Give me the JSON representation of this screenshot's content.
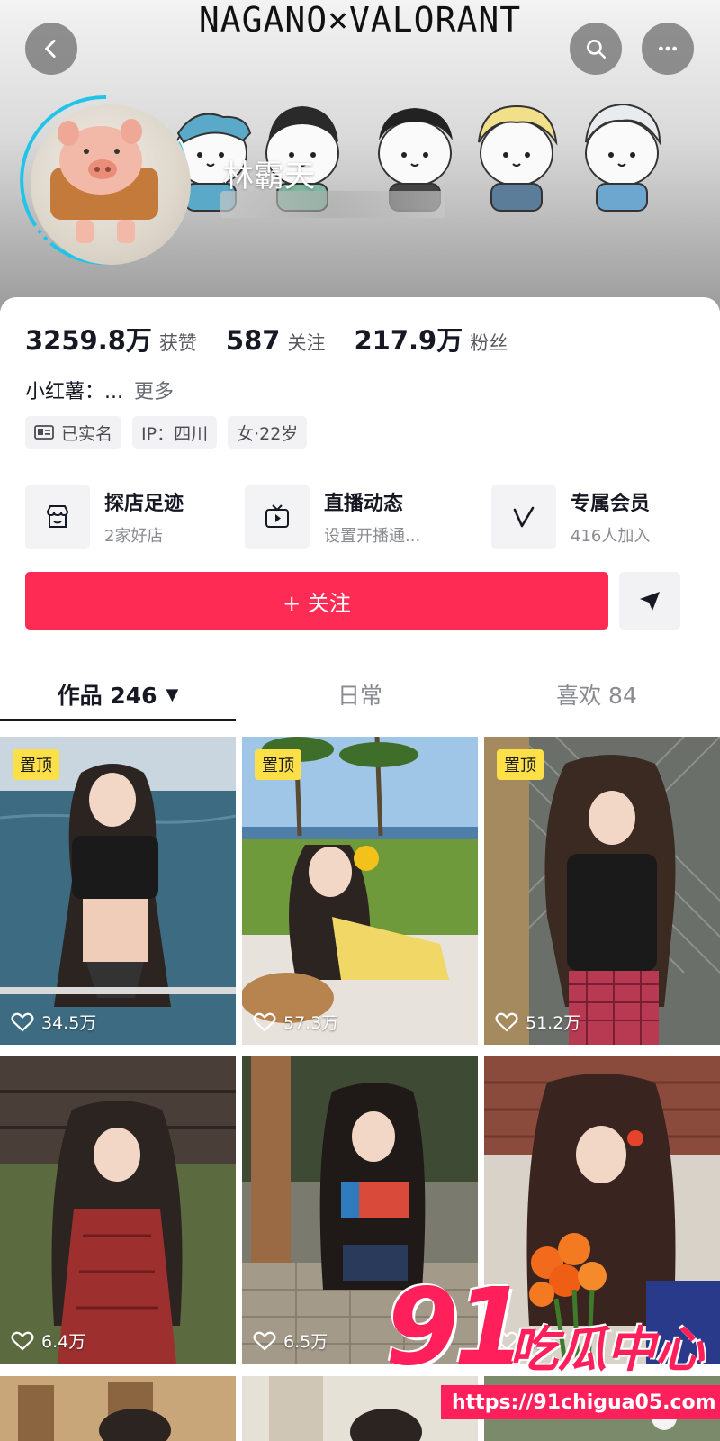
{
  "banner": {
    "title": "NAGANO×VALORANT"
  },
  "profile": {
    "nickname": "林霸天"
  },
  "stats": [
    {
      "value": "3259.8万",
      "label": "获赞"
    },
    {
      "value": "587",
      "label": "关注"
    },
    {
      "value": "217.9万",
      "label": "粉丝"
    }
  ],
  "bio": {
    "text": "小红薯：...",
    "more": "更多"
  },
  "tags": [
    {
      "icon": "id-card-icon",
      "label": "已实名"
    },
    {
      "icon": "",
      "label": "IP：四川"
    },
    {
      "icon": "",
      "label": "女·22岁"
    }
  ],
  "services": [
    {
      "icon": "shop-icon",
      "title": "探店足迹",
      "subtitle": "2家好店"
    },
    {
      "icon": "live-tv-icon",
      "title": "直播动态",
      "subtitle": "设置开播通..."
    },
    {
      "icon": "member-v-icon",
      "title": "专属会员",
      "subtitle": "416人加入"
    }
  ],
  "actions": {
    "follow_label": "+ 关注",
    "share_icon": "send-icon"
  },
  "tabs": [
    {
      "label": "作品 246",
      "active": true,
      "caret": "▼"
    },
    {
      "label": "日常",
      "active": false
    },
    {
      "label": "喜欢 84",
      "active": false
    }
  ],
  "videos": [
    {
      "pinned": true,
      "pin_label": "置顶",
      "likes": "34.5万"
    },
    {
      "pinned": true,
      "pin_label": "置顶",
      "likes": "57.3万"
    },
    {
      "pinned": true,
      "pin_label": "置顶",
      "likes": "51.2万"
    },
    {
      "pinned": false,
      "likes": "6.4万"
    },
    {
      "pinned": false,
      "likes": "6.5万"
    },
    {
      "pinned": false,
      "likes": "1万"
    }
  ],
  "watermark": {
    "number": "91",
    "text": "吃瓜中心",
    "url": "https://91chigua05.com"
  },
  "colors": {
    "accent": "#fe2c55",
    "pin": "#fde047",
    "watermark": "#ff1f5a"
  }
}
